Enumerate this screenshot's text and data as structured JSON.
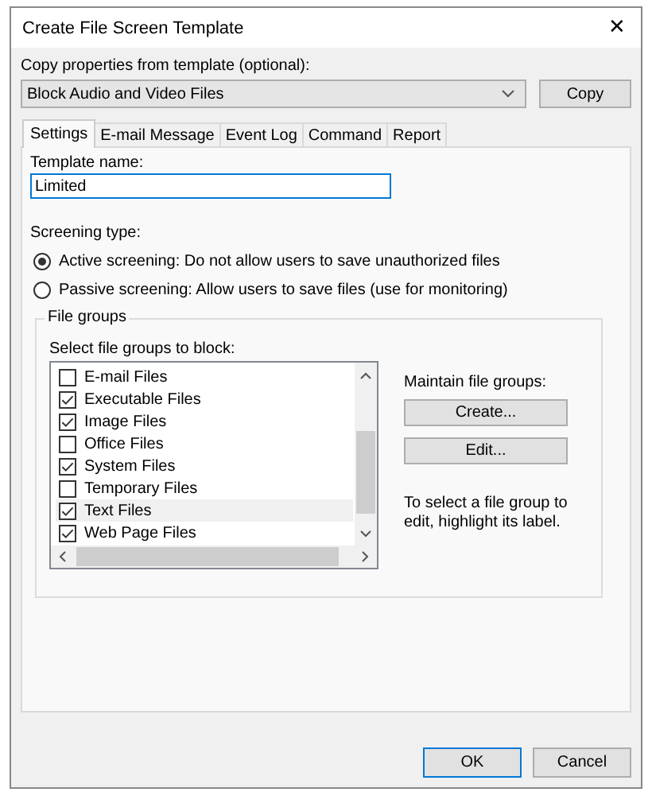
{
  "window": {
    "title": "Create File Screen Template",
    "close": "✕"
  },
  "copy_from": {
    "label": "Copy properties from template (optional):",
    "value": "Block Audio and Video Files",
    "button": "Copy"
  },
  "tabs": [
    {
      "label": "Settings",
      "selected": true
    },
    {
      "label": "E-mail Message",
      "selected": false
    },
    {
      "label": "Event Log",
      "selected": false
    },
    {
      "label": "Command",
      "selected": false
    },
    {
      "label": "Report",
      "selected": false
    }
  ],
  "template_name": {
    "label": "Template name:",
    "value": "Limited"
  },
  "screening_type": {
    "label": "Screening type:",
    "options": [
      {
        "label": "Active screening: Do not allow users to save unauthorized files",
        "selected": true
      },
      {
        "label": "Passive screening: Allow users to save files (use for monitoring)",
        "selected": false
      }
    ]
  },
  "file_groups": {
    "title": "File groups",
    "list_label": "Select file groups to block:",
    "items": [
      {
        "label": "E-mail Files",
        "checked": false,
        "selected": false
      },
      {
        "label": "Executable Files",
        "checked": true,
        "selected": false
      },
      {
        "label": "Image Files",
        "checked": true,
        "selected": false
      },
      {
        "label": "Office Files",
        "checked": false,
        "selected": false
      },
      {
        "label": "System Files",
        "checked": true,
        "selected": false
      },
      {
        "label": "Temporary Files",
        "checked": false,
        "selected": false
      },
      {
        "label": "Text Files",
        "checked": true,
        "selected": true
      },
      {
        "label": "Web Page Files",
        "checked": true,
        "selected": false
      }
    ],
    "maintain_label": "Maintain file groups:",
    "buttons": [
      "Create...",
      "Edit..."
    ],
    "hint": "To select a file group to edit, highlight its label."
  },
  "buttons": [
    {
      "label": "OK",
      "kind": "default"
    },
    {
      "label": "Cancel",
      "kind": "normal"
    }
  ]
}
